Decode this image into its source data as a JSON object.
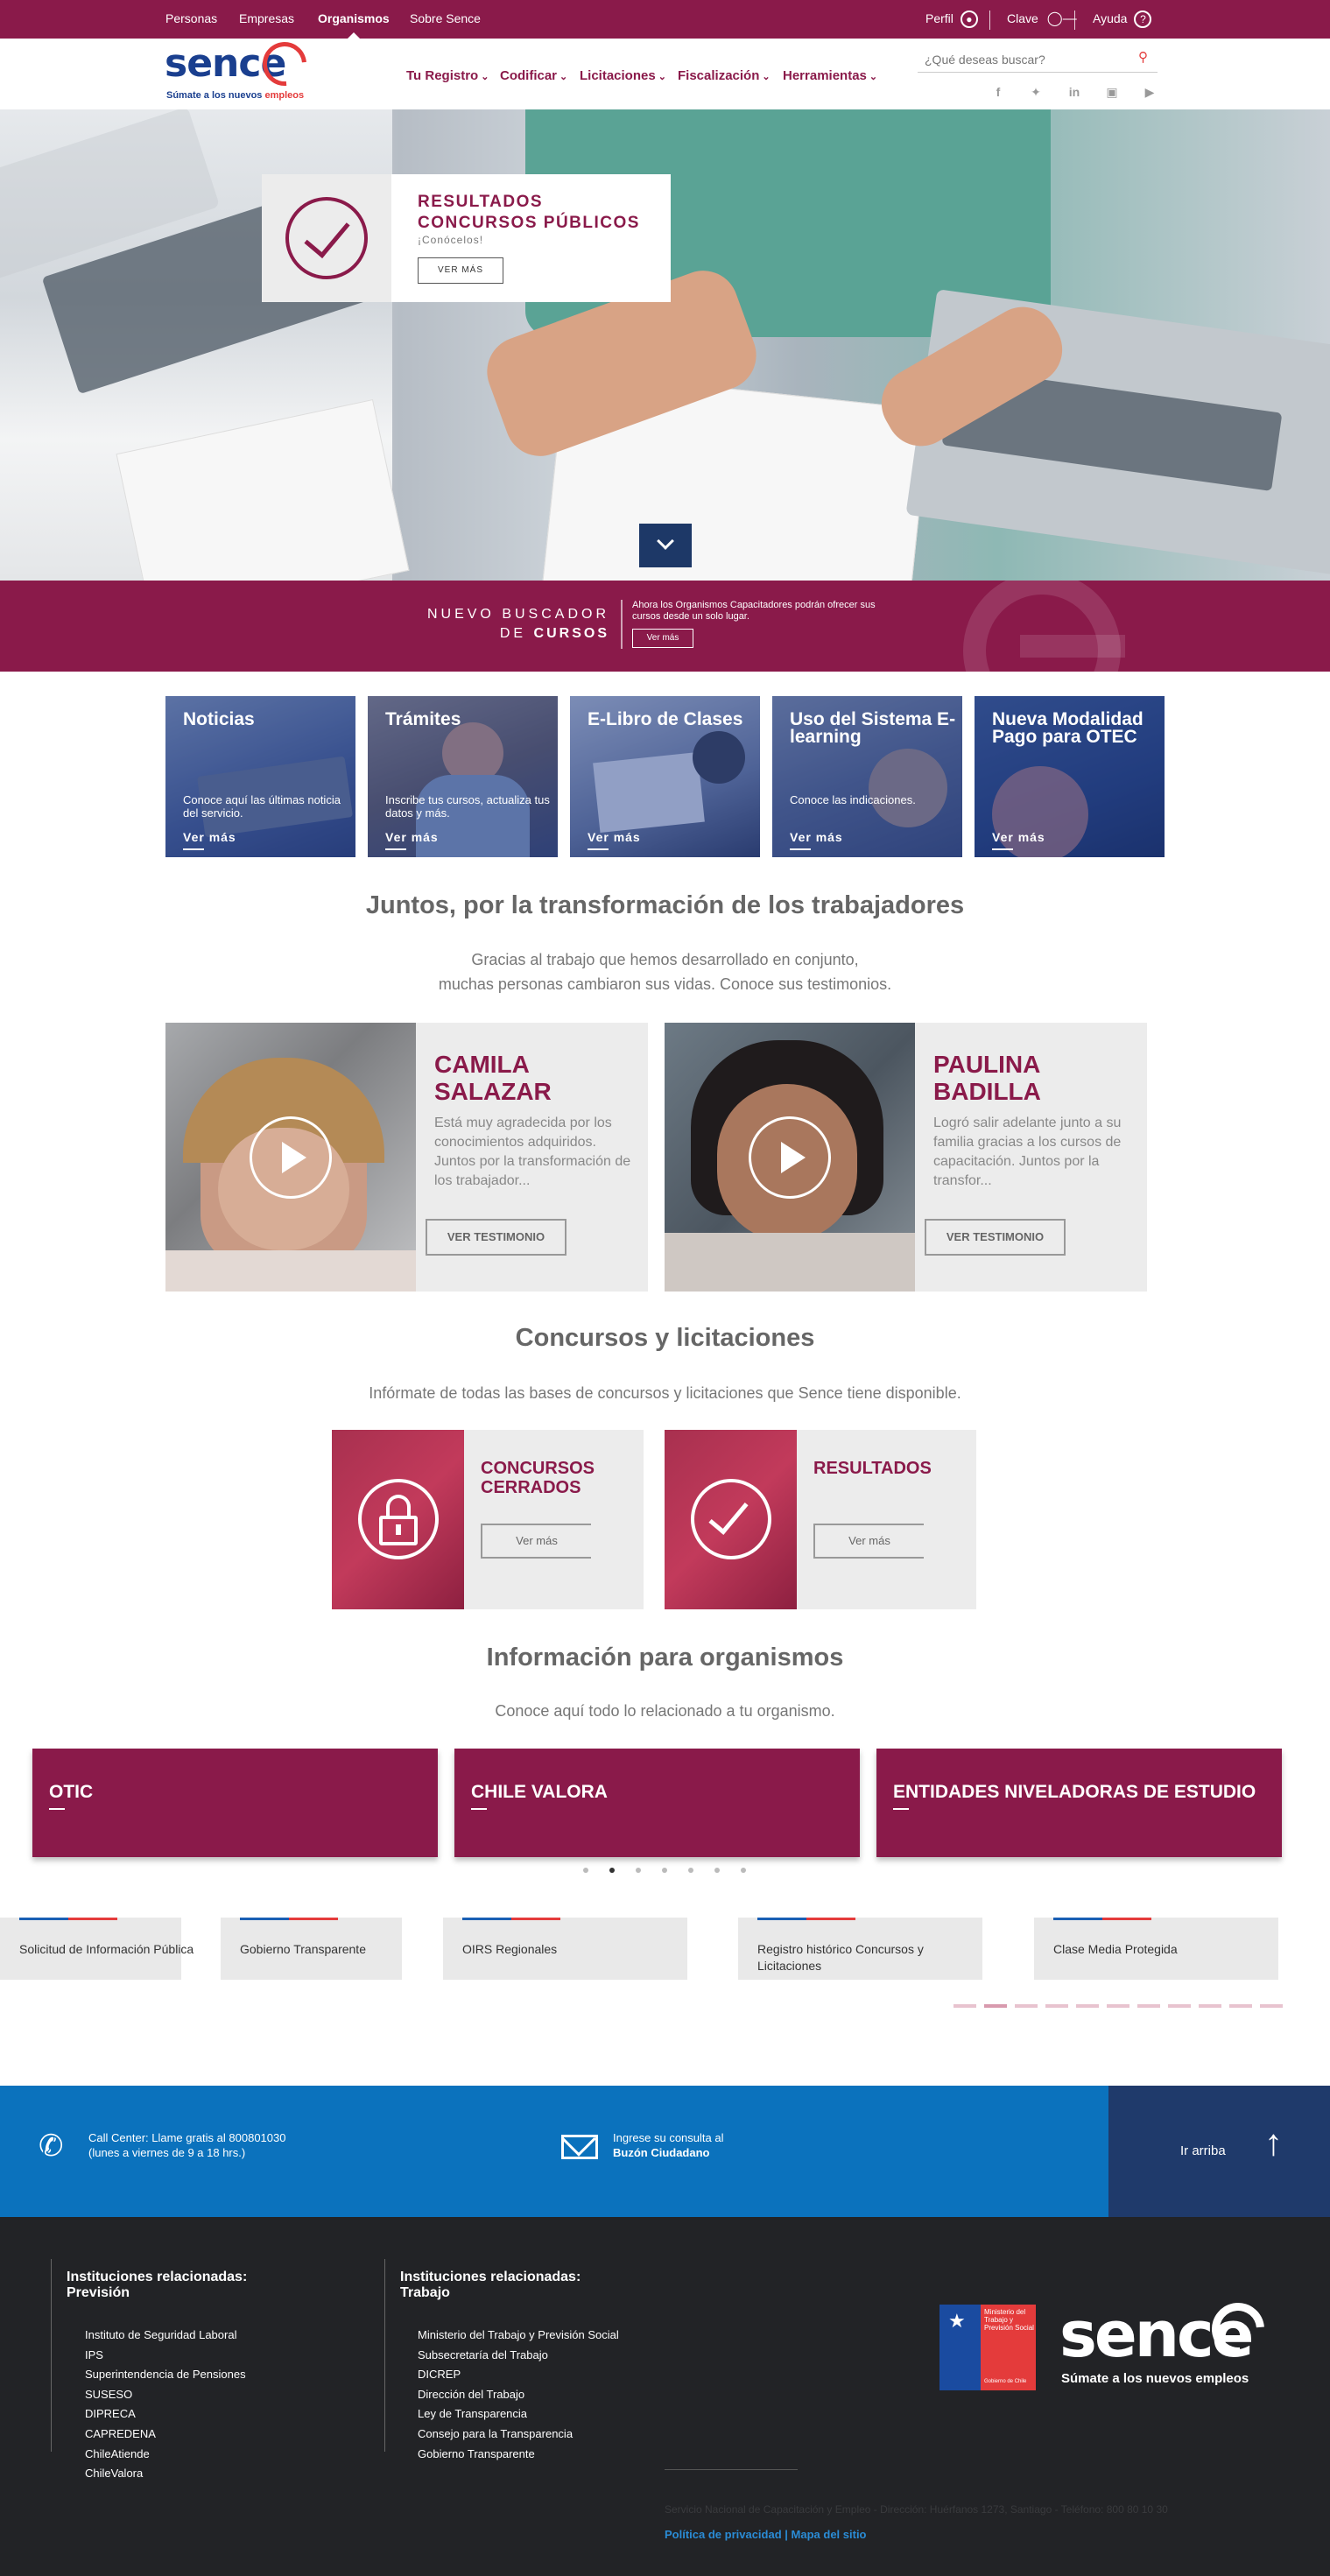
{
  "topbar": {
    "links": [
      "Personas",
      "Empresas",
      "Organismos",
      "Sobre Sence"
    ],
    "active": "Organismos",
    "perfil": "Perfil",
    "clave": "Clave",
    "ayuda": "Ayuda"
  },
  "header": {
    "logo": "sence",
    "tagline_a": "Súmate a los nuevos ",
    "tagline_b": "empleos",
    "nav": [
      "Tu Registro",
      "Codificar",
      "Licitaciones",
      "Fiscalización",
      "Herramientas"
    ],
    "search_placeholder": "¿Qué deseas buscar?",
    "social": [
      "facebook-icon",
      "twitter-icon",
      "linkedin-icon",
      "instagram-icon",
      "youtube-icon"
    ]
  },
  "hero": {
    "title_line1": "RESULTADOS",
    "title_line2": "CONCURSOS PÚBLICOS",
    "subtitle": "¡Conócelos!",
    "button": "VER MÁS"
  },
  "buscador": {
    "line1": "NUEVO BUSCADOR",
    "line2_a": "DE ",
    "line2_b": "CURSOS",
    "desc": "Ahora los Organismos Capacitadores podrán ofrecer sus cursos desde un solo lugar.",
    "button": "Ver más"
  },
  "tiles": [
    {
      "title": "Noticias",
      "text": "Conoce aquí las últimas noticia del servicio.",
      "more": "Ver más"
    },
    {
      "title": "Trámites",
      "text": "Inscribe tus cursos, actualiza tus datos y más.",
      "more": "Ver más"
    },
    {
      "title": "E-Libro de Clases",
      "text": "",
      "more": "Ver más"
    },
    {
      "title": "Uso del Sistema E-learning",
      "text": "Conoce las indicaciones.",
      "more": "Ver más"
    },
    {
      "title": "Nueva Modalidad Pago para OTEC",
      "text": "",
      "more": "Ver más"
    }
  ],
  "testimonios": {
    "title": "Juntos, por la transformación de los trabajadores",
    "text_line1": "Gracias al trabajo que hemos desarrollado en conjunto,",
    "text_line2": "muchas personas cambiaron sus vidas. Conoce sus testimonios.",
    "items": [
      {
        "name_line1": "CAMILA",
        "name_line2": "SALAZAR",
        "text": "Está muy agradecida por los conocimientos adquiridos. Juntos por la transformación de los trabajador...",
        "button": "VER TESTIMONIO"
      },
      {
        "name_line1": "PAULINA",
        "name_line2": "BADILLA",
        "text": "Logró salir adelante junto a su familia gracias a los cursos de capacitación. Juntos por la transfor...",
        "button": "VER TESTIMONIO"
      }
    ]
  },
  "concursos": {
    "title": "Concursos y licitaciones",
    "text": "Infórmate de todas las bases de concursos y licitaciones que Sence tiene disponible.",
    "items": [
      {
        "title_line1": "CONCURSOS",
        "title_line2": "CERRADOS",
        "button": "Ver más"
      },
      {
        "title_line1": "RESULTADOS",
        "title_line2": "",
        "button": "Ver más"
      }
    ]
  },
  "organismos": {
    "title": "Información para organismos",
    "text": "Conoce aquí todo lo relacionado a tu organismo.",
    "cards": [
      "OTIC",
      "CHILE VALORA",
      "ENTIDADES NIVELADORAS DE ESTUDIO"
    ],
    "carousel_active": 1
  },
  "link_cards": [
    "Solicitud de Información Pública",
    "Gobierno Transparente",
    "OIRS Regionales",
    "Registro histórico Concursos y Licitaciones",
    "Clase Media Protegida"
  ],
  "contact": {
    "callcenter_line1": "Call Center: Llame gratis al 800801030",
    "callcenter_line2": "(lunes a viernes de 9 a 18 hrs.)",
    "buzon_line1": "Ingrese su consulta al",
    "buzon_line2": "Buzón Ciudadano",
    "arriba": "Ir arriba"
  },
  "footer": {
    "col1_title_line1": "Instituciones relacionadas:",
    "col1_title_line2": "Previsión",
    "col1_items": [
      "Instituto de Seguridad Laboral",
      "IPS",
      "Superintendencia de Pensiones",
      "SUSESO",
      "DIPRECA",
      "CAPREDENA",
      "ChileAtiende",
      "ChileValora"
    ],
    "col2_title_line1": "Instituciones relacionadas:",
    "col2_title_line2": "Trabajo",
    "col2_items": [
      "Ministerio del Trabajo y Previsión Social",
      "Subsecretaría del Trabajo",
      "DICREP",
      "Dirección del Trabajo",
      "Ley de Transparencia",
      "Consejo para la Transparencia",
      "Gobierno Transparente"
    ],
    "gob_text": "Ministerio del Trabajo y Previsión Social",
    "gob_small": "Gobierno de Chile",
    "logo": "sence",
    "tagline": "Súmate a los nuevos empleos",
    "address": "Servicio Nacional de Capacitación y Empleo - Dirección: Huérfanos 1273, Santiago - Teléfono: 800 80 10 30",
    "privacy": "Política de privacidad",
    "mapa": "Mapa del sitio"
  },
  "colors": {
    "brand": "#8a1a4a",
    "navy": "#1d3867",
    "blue": "#0b72bd",
    "footer": "#222326"
  }
}
